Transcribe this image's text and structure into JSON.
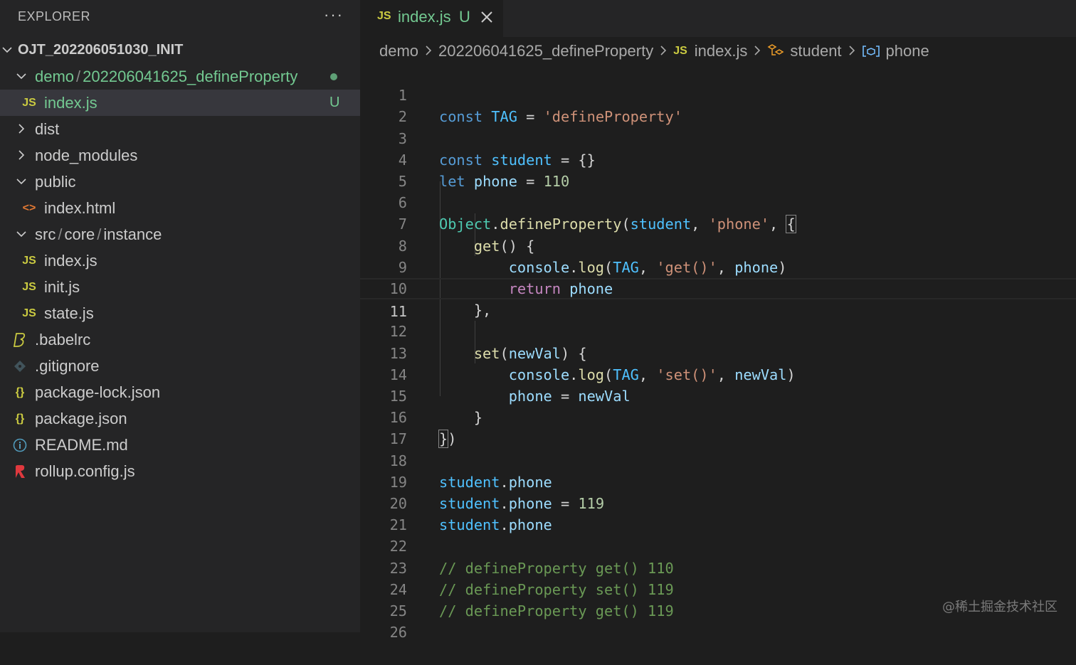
{
  "sidebar": {
    "title": "EXPLORER",
    "more_label": "···",
    "root_folder": "OJT_20220605​1030_INIT",
    "items": [
      {
        "label_a": "demo",
        "label_b": "202206041625_defineProperty",
        "type": "folder-open",
        "status": "dot"
      },
      {
        "label": "index.js",
        "type": "js",
        "icon": "JS",
        "status": "U"
      },
      {
        "label": "dist",
        "type": "folder-closed"
      },
      {
        "label": "node_modules",
        "type": "folder-closed"
      },
      {
        "label": "public",
        "type": "folder-open"
      },
      {
        "label": "index.html",
        "type": "html",
        "icon": "<>"
      },
      {
        "label_a": "src",
        "label_b": "core",
        "label_c": "instance",
        "type": "folder-open"
      },
      {
        "label": "index.js",
        "type": "js",
        "icon": "JS"
      },
      {
        "label": "init.js",
        "type": "js",
        "icon": "JS"
      },
      {
        "label": "state.js",
        "type": "js",
        "icon": "JS"
      },
      {
        "label": ".babelrc",
        "type": "babel"
      },
      {
        "label": ".gitignore",
        "type": "git"
      },
      {
        "label": "package-lock.json",
        "type": "json",
        "icon": "{}"
      },
      {
        "label": "package.json",
        "type": "json",
        "icon": "{}"
      },
      {
        "label": "README.md",
        "type": "info"
      },
      {
        "label": "rollup.config.js",
        "type": "rollup"
      }
    ],
    "separator": "/"
  },
  "tab": {
    "icon": "JS",
    "label": "index.js",
    "status": "U"
  },
  "breadcrumb": {
    "items": [
      "demo",
      "202206041625_defineProperty",
      "index.js",
      "student",
      "phone"
    ],
    "js_icon": "JS"
  },
  "code": {
    "current_line": 11,
    "line_numbers": [
      "1",
      "2",
      "3",
      "4",
      "5",
      "6",
      "7",
      "8",
      "9",
      "10",
      "11",
      "12",
      "13",
      "14",
      "15",
      "16",
      "17",
      "18",
      "19",
      "20",
      "21",
      "22",
      "23",
      "24",
      "25",
      "26"
    ],
    "tokens": {
      "const": "const",
      "let": "let",
      "return": "return",
      "TAG": "TAG",
      "eq": " = ",
      "defineProperty_str": "'defineProperty'",
      "student": "student",
      "braces": "{}",
      "phone": "phone",
      "n110": "110",
      "n119": "119",
      "Object": "Object",
      "defineProperty": "defineProperty",
      "phone_str": "'phone'",
      "get": "get",
      "set": "set",
      "console": "console",
      "log": "log",
      "get_str": "'get()'",
      "set_str": "'set()'",
      "newVal": "newVal",
      "comment1": "// defineProperty get() 110",
      "comment2": "// defineProperty set() 119",
      "comment3": "// defineProperty get() 119"
    }
  },
  "watermark": "@稀土掘金技术社区",
  "colors": {
    "untracked": "#73c991",
    "keyword": "#569cd6",
    "string": "#ce9178",
    "function": "#dcdcaa",
    "comment": "#6a9955"
  }
}
